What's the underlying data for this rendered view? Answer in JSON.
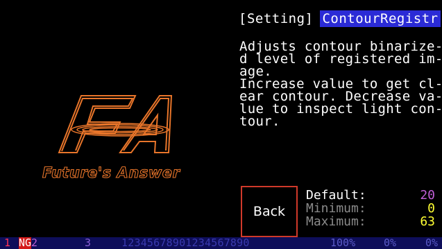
{
  "header": {
    "prefix": "[Setting]",
    "mode": "ContourRegistr"
  },
  "description": "Adjusts contour binarize-\nd level of registered im-\nage.\nIncrease value to get cl-\near contour. Decrease va-\nlue to inspect light con-\ntour.",
  "logo": {
    "brand": "FA",
    "tagline": "Future's Answer",
    "color": "#e8752a"
  },
  "back_button": {
    "label": "Back"
  },
  "values": {
    "default_label": "Default:",
    "default_value": "20",
    "minimum_label": "Minimum:",
    "minimum_value": "0",
    "maximum_label": "Maximum:",
    "maximum_value": "63"
  },
  "status_bar": {
    "slot1": "1",
    "ng": "NG",
    "slot2": "2",
    "slot3": "3",
    "digits": "12345678901234567890",
    "pct1": "100%",
    "pct2": "0%",
    "pct3": "0%"
  },
  "colors": {
    "accent_blue": "#2b2bd6",
    "border_red": "#d0392a",
    "value_yellow": "#ffff33",
    "value_purple": "#c05fd6"
  }
}
